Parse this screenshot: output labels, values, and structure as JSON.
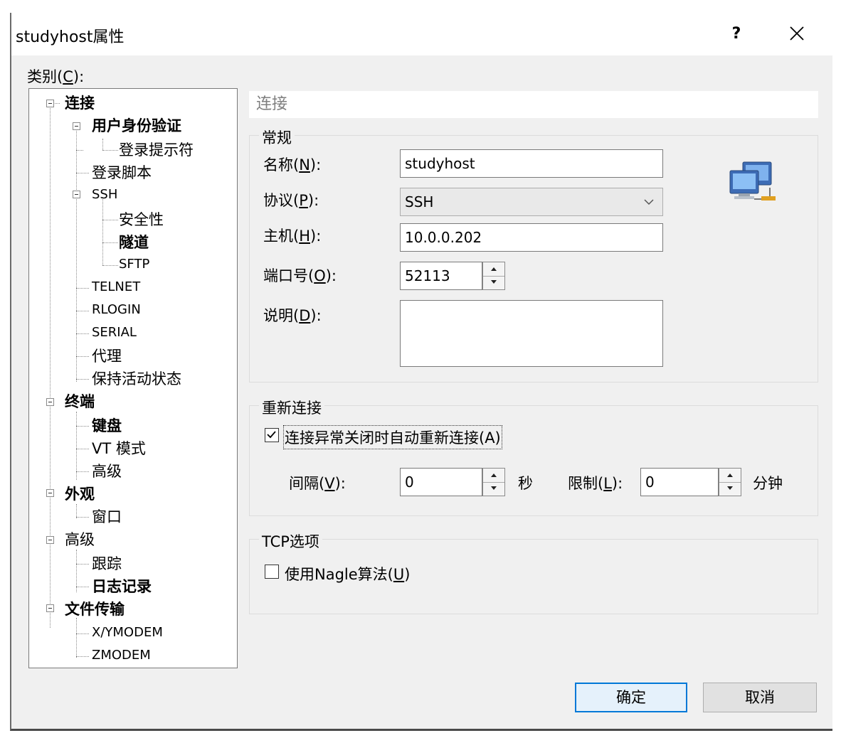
{
  "window": {
    "title": "studyhost属性",
    "help_label": "?"
  },
  "category": {
    "label_prefix": "类别(",
    "label_key": "C",
    "label_suffix": "):"
  },
  "tree": [
    {
      "label": "连接",
      "bold": true
    },
    {
      "label": "用户身份验证",
      "bold": true
    },
    {
      "label": "登录提示符",
      "bold": false
    },
    {
      "label": "登录脚本",
      "bold": false
    },
    {
      "label": "SSH",
      "bold": false
    },
    {
      "label": "安全性",
      "bold": false
    },
    {
      "label": "隧道",
      "bold": true
    },
    {
      "label": "SFTP",
      "bold": false
    },
    {
      "label": "TELNET",
      "bold": false
    },
    {
      "label": "RLOGIN",
      "bold": false
    },
    {
      "label": "SERIAL",
      "bold": false
    },
    {
      "label": "代理",
      "bold": false
    },
    {
      "label": "保持活动状态",
      "bold": false
    },
    {
      "label": "终端",
      "bold": true
    },
    {
      "label": "键盘",
      "bold": true
    },
    {
      "label": "VT 模式",
      "bold": false
    },
    {
      "label": "高级",
      "bold": false
    },
    {
      "label": "外观",
      "bold": true
    },
    {
      "label": "窗口",
      "bold": false
    },
    {
      "label": "高级",
      "bold": false
    },
    {
      "label": "跟踪",
      "bold": false
    },
    {
      "label": "日志记录",
      "bold": true
    },
    {
      "label": "文件传输",
      "bold": true
    },
    {
      "label": "X/YMODEM",
      "bold": false
    },
    {
      "label": "ZMODEM",
      "bold": false
    }
  ],
  "section_header": "连接",
  "general": {
    "title": "常规",
    "name_label": "名称(",
    "name_key": "N",
    "name_suffix": "):",
    "name_value": "studyhost",
    "protocol_label": "协议(",
    "protocol_key": "P",
    "protocol_suffix": "):",
    "protocol_value": "SSH",
    "host_label": "主机(",
    "host_key": "H",
    "host_suffix": "):",
    "host_value": "10.0.0.202",
    "port_label": "端口号(",
    "port_key": "O",
    "port_suffix": "):",
    "port_value": "52113",
    "desc_label": "说明(",
    "desc_key": "D",
    "desc_suffix": "):",
    "desc_value": ""
  },
  "reconnect": {
    "title": "重新连接",
    "checkbox_label": "连接异常关闭时自动重新连接(A)",
    "checked": true,
    "interval_label": "间隔(",
    "interval_key": "V",
    "interval_suffix": "):",
    "interval_value": "0",
    "interval_unit": "秒",
    "limit_label": "限制(",
    "limit_key": "L",
    "limit_suffix": "):",
    "limit_value": "0",
    "limit_unit": "分钟"
  },
  "tcp": {
    "title": "TCP选项",
    "nagle_label": "使用Nagle算法(",
    "nagle_key": "U",
    "nagle_suffix": ")",
    "checked": false
  },
  "buttons": {
    "ok": "确定",
    "cancel": "取消"
  },
  "colors": {
    "dialog_bg": "#f0f0f0",
    "accent": "#0078d7"
  }
}
